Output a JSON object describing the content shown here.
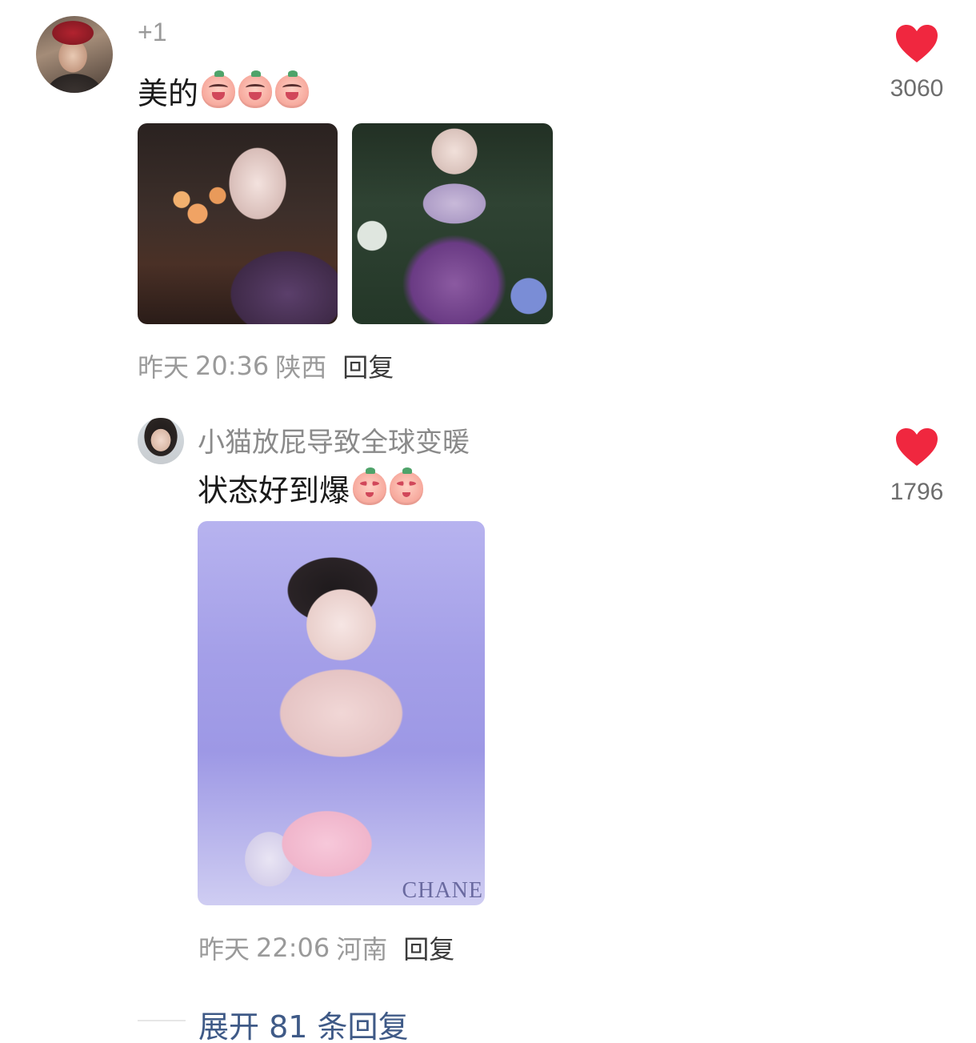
{
  "comments": [
    {
      "tag": "+1",
      "text": "美的",
      "emoji": [
        "grin-emoji",
        "grin-emoji",
        "grin-emoji"
      ],
      "time_day": "昨天",
      "time_clock": "20:36",
      "location": "陕西",
      "reply_label": "回复",
      "likes": "3060",
      "photos": [
        "photo-evening-gown",
        "photo-garden-gown"
      ]
    },
    {
      "username": "小猫放屁导致全球变暖",
      "text": "状态好到爆",
      "emoji": [
        "star-eyes-emoji",
        "star-eyes-emoji"
      ],
      "time_day": "昨天",
      "time_clock": "22:06",
      "location": "河南",
      "reply_label": "回复",
      "likes": "1796",
      "photo_brand_text": "CHANE",
      "photos": [
        "photo-product-promo"
      ]
    }
  ],
  "expand_replies": "展开 81 条回复",
  "colors": {
    "heart": "#f0273f",
    "expand_link": "#3f5a87",
    "meta_text": "#9a9a9a"
  },
  "icons": {
    "like": "heart-icon"
  }
}
